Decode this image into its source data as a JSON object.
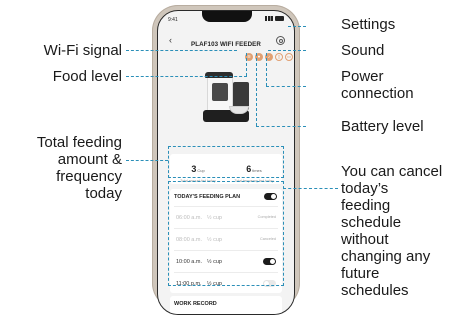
{
  "phone": {
    "status_time": "9:41",
    "back_icon": "chevron-left",
    "title": "PLAF103 WIFI FEEDER",
    "status_icons": [
      "wifi",
      "food",
      "sound",
      "power",
      "battery"
    ],
    "stats": [
      {
        "num": "3",
        "unit": "Cup",
        "label": "Total amount fed today"
      },
      {
        "num": "6",
        "unit": "times",
        "label": "Total frequency fed today"
      }
    ],
    "plan_title": "TODAY'S FEEDING PLAN",
    "plan_toggle_on": true,
    "rows": [
      {
        "time": "06:00 a.m.",
        "amount": "½ cup",
        "status": "Completed",
        "dim": true
      },
      {
        "time": "08:00 a.m.",
        "amount": "½ cup",
        "status": "Canceled",
        "dim": true
      },
      {
        "time": "10:00 a.m.",
        "amount": "½ cup",
        "status": "",
        "toggle": "on"
      },
      {
        "time": "11:00 p.m.",
        "amount": "½ cup",
        "status": "",
        "toggle": "off"
      }
    ],
    "work_record": "WORK RECORD"
  },
  "callouts": {
    "settings": "Settings",
    "wifi": "Wi-Fi signal",
    "sound": "Sound",
    "food": "Food level",
    "power_1": "Power",
    "power_2": "connection",
    "battery": "Battery level",
    "total_1": "Total feeding",
    "total_2": "amount &",
    "total_3": "frequency",
    "total_4": "today",
    "cancel_1": "You can cancel",
    "cancel_2": "today’s",
    "cancel_3": "feeding",
    "cancel_4": "schedule",
    "cancel_5": "without",
    "cancel_6": "changing any",
    "cancel_7": "future",
    "cancel_8": "schedules"
  },
  "accent_color": "#2b8fb8",
  "icon_color": "#e1a072"
}
